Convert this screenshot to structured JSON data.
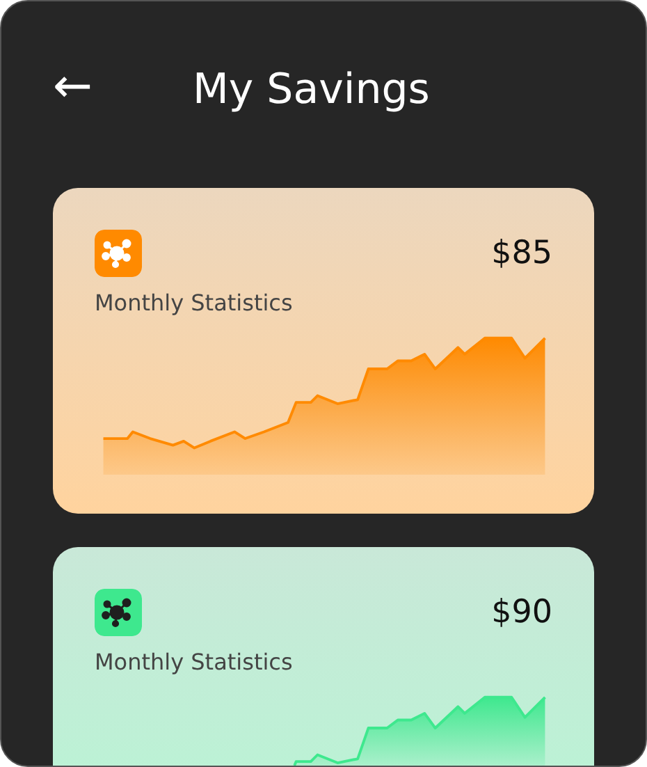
{
  "header": {
    "back_icon": "←",
    "title": "My Savings"
  },
  "cards": [
    {
      "amount": "$85",
      "label": "Monthly Statistics",
      "color": "#ff8a00"
    },
    {
      "amount": "$90",
      "label": "Monthly Statistics",
      "color": "#3ee88e"
    }
  ]
}
